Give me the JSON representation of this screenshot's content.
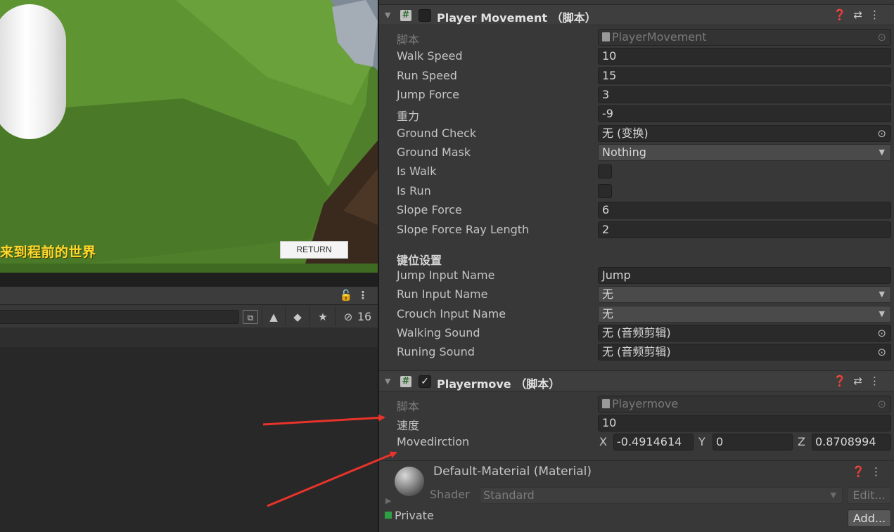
{
  "scene": {
    "caption": "来到程前的世界",
    "return_button": "RETURN"
  },
  "lower_panel": {
    "hidden_count": "16",
    "icons": [
      "lock-icon",
      "more-icon",
      "link-icon",
      "scene-filter-icon",
      "tag-icon",
      "star-icon",
      "visibility-off-icon"
    ]
  },
  "player_movement": {
    "title": "Player Movement （脚本）",
    "enabled": false,
    "header_icons": [
      "help-icon",
      "preset-icon",
      "more-icon"
    ],
    "fields": [
      {
        "label": "脚本",
        "value": "PlayerMovement",
        "kind": "script"
      },
      {
        "label": "Walk Speed",
        "value": "10",
        "kind": "text"
      },
      {
        "label": "Run Speed",
        "value": "15",
        "kind": "text"
      },
      {
        "label": "Jump Force",
        "value": "3",
        "kind": "text"
      },
      {
        "label": "重力",
        "value": "-9",
        "kind": "text"
      },
      {
        "label": "Ground Check",
        "value": "无 (变换)",
        "kind": "object"
      },
      {
        "label": "Ground Mask",
        "value": "Nothing",
        "kind": "dropdown"
      },
      {
        "label": "Is Walk",
        "value": false,
        "kind": "checkbox"
      },
      {
        "label": "Is Run",
        "value": false,
        "kind": "checkbox"
      },
      {
        "label": "Slope Force",
        "value": "6",
        "kind": "text"
      },
      {
        "label": "Slope Force Ray Length",
        "value": "2",
        "kind": "text"
      }
    ],
    "section": "键位设置",
    "section_fields": [
      {
        "label": "Jump Input Name",
        "value": "Jump",
        "kind": "text"
      },
      {
        "label": "Run Input Name",
        "value": "无",
        "kind": "dropdown"
      },
      {
        "label": "Crouch Input Name",
        "value": "无",
        "kind": "dropdown"
      },
      {
        "label": "Walking Sound",
        "value": "无 (音频剪辑)",
        "kind": "object"
      },
      {
        "label": "Runing Sound",
        "value": "无 (音频剪辑)",
        "kind": "object"
      }
    ]
  },
  "playermove": {
    "title": "Playermove （脚本）",
    "enabled": true,
    "script_label": "脚本",
    "script_value": "Playermove",
    "speed_label": "速度",
    "speed_value": "10",
    "movedir_label": "Movedirction",
    "x_label": "X",
    "x_value": "-0.4914614",
    "y_label": "Y",
    "y_value": "0",
    "z_label": "Z",
    "z_value": "0.8708994"
  },
  "material": {
    "title": "Default-Material (Material)",
    "shader_label": "Shader",
    "shader_value": "Standard",
    "edit_button": "Edit...",
    "private_label": "Private",
    "add_button": "Add..."
  },
  "colors": {
    "inspector_bg": "#383838",
    "field_bg": "#2a2a2a",
    "scene_text": "#ffd92e",
    "annotation_arrow": "#e8332a"
  }
}
